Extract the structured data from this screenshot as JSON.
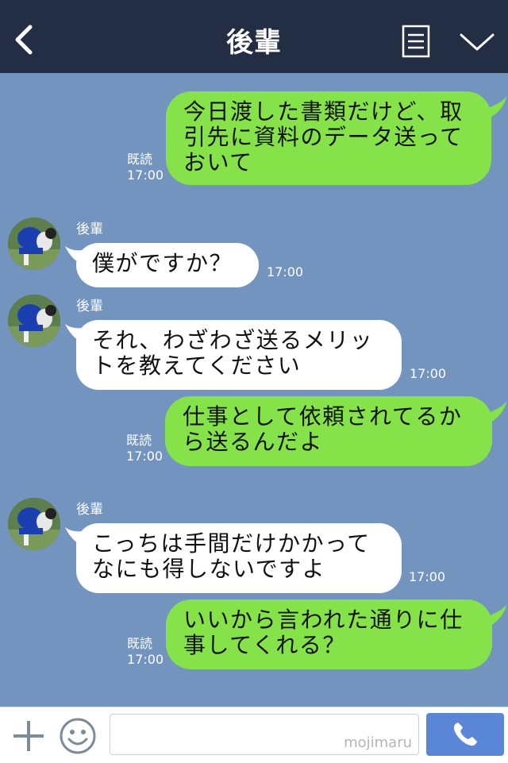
{
  "header": {
    "title": "後輩"
  },
  "messages": [
    {
      "dir": "out",
      "text_lines": [
        "今日渡した書類だけど、取",
        "引先に資料のデータ送って",
        "おいて"
      ],
      "read": "既読",
      "time": "17:00"
    },
    {
      "dir": "in",
      "sender": "後輩",
      "text_lines": [
        "僕がですか？"
      ],
      "time": "17:00"
    },
    {
      "dir": "in",
      "sender": "後輩",
      "text_lines": [
        "それ、わざわざ送るメリッ",
        "トを教えてください"
      ],
      "time": "17:00"
    },
    {
      "dir": "out",
      "text_lines": [
        "仕事として依頼されてるか",
        "ら送るんだよ"
      ],
      "read": "既読",
      "time": "17:00"
    },
    {
      "dir": "in",
      "sender": "後輩",
      "text_lines": [
        "こっちは手間だけかかって",
        "なにも得しないですよ"
      ],
      "time": "17:00"
    },
    {
      "dir": "out",
      "text_lines": [
        "いいから言われた通りに仕",
        "事してくれる？"
      ],
      "read": "既読",
      "time": "17:00"
    }
  ],
  "footer": {
    "watermark": "mojimaru"
  },
  "colors": {
    "background": "#7494c0",
    "header": "#232d43",
    "outgoing_bubble": "#85e249",
    "incoming_bubble": "#ffffff",
    "call_button": "#5a86d8"
  }
}
